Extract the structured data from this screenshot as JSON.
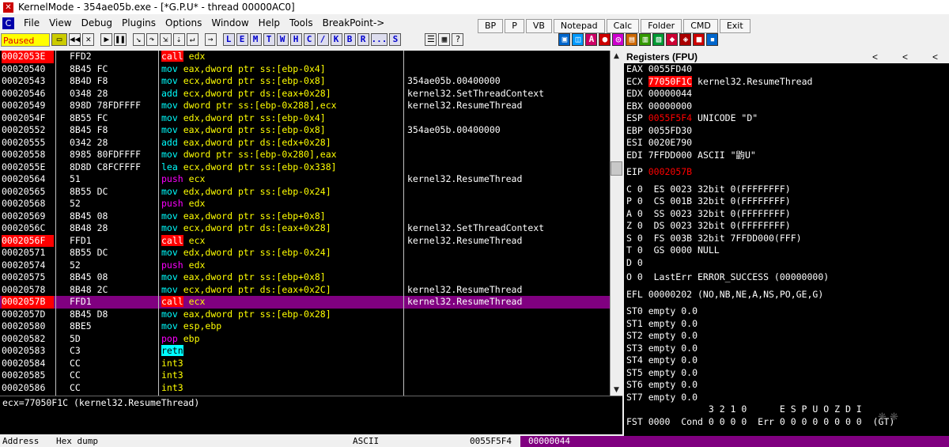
{
  "window": {
    "title": "KernelMode - 354ae05b.exe - [*G.P.U* - thread 00000AC0]"
  },
  "menu": [
    "File",
    "View",
    "Debug",
    "Plugins",
    "Options",
    "Window",
    "Help",
    "Tools",
    "BreakPoint->"
  ],
  "plugins": [
    "BP",
    "P",
    "VB",
    "Notepad",
    "Calc",
    "Folder",
    "CMD",
    "Exit"
  ],
  "status": "Paused",
  "toolbar_letters": [
    "L",
    "E",
    "M",
    "T",
    "W",
    "H",
    "C",
    "/",
    "K",
    "B",
    "R",
    "...",
    "S"
  ],
  "disasm": [
    {
      "addr": "0002053E",
      "hex": "FFD2",
      "op": "call",
      "args": "edx",
      "cmt": "",
      "addr_red": true,
      "sel": false
    },
    {
      "addr": "00020540",
      "hex": "8B45 FC",
      "op": "mov",
      "args": "eax,dword ptr ss:[ebp-0x4]",
      "cmt": ""
    },
    {
      "addr": "00020543",
      "hex": "8B4D F8",
      "op": "mov",
      "args": "ecx,dword ptr ss:[ebp-0x8]",
      "cmt": "354ae05b.00400000"
    },
    {
      "addr": "00020546",
      "hex": "0348 28",
      "op": "add",
      "args": "ecx,dword ptr ds:[eax+0x28]",
      "cmt": "kernel32.SetThreadContext"
    },
    {
      "addr": "00020549",
      "hex": "898D 78FDFFFF",
      "op": "mov",
      "args": "dword ptr ss:[ebp-0x288],ecx",
      "cmt": "kernel32.ResumeThread"
    },
    {
      "addr": "0002054F",
      "hex": "8B55 FC",
      "op": "mov",
      "args": "edx,dword ptr ss:[ebp-0x4]",
      "cmt": ""
    },
    {
      "addr": "00020552",
      "hex": "8B45 F8",
      "op": "mov",
      "args": "eax,dword ptr ss:[ebp-0x8]",
      "cmt": "354ae05b.00400000"
    },
    {
      "addr": "00020555",
      "hex": "0342 28",
      "op": "add",
      "args": "eax,dword ptr ds:[edx+0x28]",
      "cmt": ""
    },
    {
      "addr": "00020558",
      "hex": "8985 80FDFFFF",
      "op": "mov",
      "args": "dword ptr ss:[ebp-0x280],eax",
      "cmt": ""
    },
    {
      "addr": "0002055E",
      "hex": "8D8D C8FCFFFF",
      "op": "lea",
      "args": "ecx,dword ptr ss:[ebp-0x338]",
      "cmt": ""
    },
    {
      "addr": "00020564",
      "hex": "51",
      "op": "push",
      "args": "ecx",
      "cmt": "kernel32.ResumeThread"
    },
    {
      "addr": "00020565",
      "hex": "8B55 DC",
      "op": "mov",
      "args": "edx,dword ptr ss:[ebp-0x24]",
      "cmt": ""
    },
    {
      "addr": "00020568",
      "hex": "52",
      "op": "push",
      "args": "edx",
      "cmt": ""
    },
    {
      "addr": "00020569",
      "hex": "8B45 08",
      "op": "mov",
      "args": "eax,dword ptr ss:[ebp+0x8]",
      "cmt": ""
    },
    {
      "addr": "0002056C",
      "hex": "8B48 28",
      "op": "mov",
      "args": "ecx,dword ptr ds:[eax+0x28]",
      "cmt": "kernel32.SetThreadContext"
    },
    {
      "addr": "0002056F",
      "hex": "FFD1",
      "op": "call",
      "args": "ecx",
      "cmt": "kernel32.ResumeThread",
      "addr_red": true
    },
    {
      "addr": "00020571",
      "hex": "8B55 DC",
      "op": "mov",
      "args": "edx,dword ptr ss:[ebp-0x24]",
      "cmt": ""
    },
    {
      "addr": "00020574",
      "hex": "52",
      "op": "push",
      "args": "edx",
      "cmt": ""
    },
    {
      "addr": "00020575",
      "hex": "8B45 08",
      "op": "mov",
      "args": "eax,dword ptr ss:[ebp+0x8]",
      "cmt": ""
    },
    {
      "addr": "00020578",
      "hex": "8B48 2C",
      "op": "mov",
      "args": "ecx,dword ptr ds:[eax+0x2C]",
      "cmt": "kernel32.ResumeThread"
    },
    {
      "addr": "0002057B",
      "hex": "FFD1",
      "op": "call",
      "args": "ecx",
      "cmt": "kernel32.ResumeThread",
      "addr_red": true,
      "sel": true
    },
    {
      "addr": "0002057D",
      "hex": "8B45 D8",
      "op": "mov",
      "args": "eax,dword ptr ss:[ebp-0x28]",
      "cmt": ""
    },
    {
      "addr": "00020580",
      "hex": "8BE5",
      "op": "mov",
      "args": "esp,ebp",
      "cmt": ""
    },
    {
      "addr": "00020582",
      "hex": "5D",
      "op": "pop",
      "args": "ebp",
      "cmt": ""
    },
    {
      "addr": "00020583",
      "hex": "C3",
      "op": "retn",
      "args": "",
      "cmt": ""
    },
    {
      "addr": "00020584",
      "hex": "CC",
      "op": "int3",
      "args": "",
      "cmt": ""
    },
    {
      "addr": "00020585",
      "hex": "CC",
      "op": "int3",
      "args": "",
      "cmt": ""
    },
    {
      "addr": "00020586",
      "hex": "CC",
      "op": "int3",
      "args": "",
      "cmt": ""
    }
  ],
  "info_line": "ecx=77050F1C (kernel32.ResumeThread)",
  "registers": {
    "title": "Registers (FPU)",
    "gp": [
      {
        "name": "EAX",
        "value": "0055FD40",
        "note": "",
        "hl": false
      },
      {
        "name": "ECX",
        "value": "77050F1C",
        "note": "kernel32.ResumeThread",
        "hl": true
      },
      {
        "name": "EDX",
        "value": "00000044",
        "note": "",
        "hl": false
      },
      {
        "name": "EBX",
        "value": "00000000",
        "note": "",
        "hl": false
      },
      {
        "name": "ESP",
        "value": "0055F5F4",
        "note": "UNICODE \"D\"",
        "hl": "text"
      },
      {
        "name": "EBP",
        "value": "0055FD30",
        "note": "",
        "hl": false
      },
      {
        "name": "ESI",
        "value": "0020E790",
        "note": "",
        "hl": false
      },
      {
        "name": "EDI",
        "value": "7FFDD000",
        "note": "ASCII \"鼩U\"",
        "hl": false
      }
    ],
    "eip": {
      "name": "EIP",
      "value": "0002057B"
    },
    "flags": [
      "C 0  ES 0023 32bit 0(FFFFFFFF)",
      "P 0  CS 001B 32bit 0(FFFFFFFF)",
      "A 0  SS 0023 32bit 0(FFFFFFFF)",
      "Z 0  DS 0023 32bit 0(FFFFFFFF)",
      "S 0  FS 003B 32bit 7FFDD000(FFF)",
      "T 0  GS 0000 NULL",
      "D 0",
      "O 0  LastErr ERROR_SUCCESS (00000000)"
    ],
    "efl": "EFL 00000202 (NO,NB,NE,A,NS,PO,GE,G)",
    "st": [
      "ST0 empty 0.0",
      "ST1 empty 0.0",
      "ST2 empty 0.0",
      "ST3 empty 0.0",
      "ST4 empty 0.0",
      "ST5 empty 0.0",
      "ST6 empty 0.0",
      "ST7 empty 0.0"
    ],
    "fpu_header": "               3 2 1 0      E S P U O Z D I",
    "fst": "FST 0000  Cond 0 0 0 0  Err 0 0 0 0 0 0 0 0  (GT)"
  },
  "bottom": {
    "address": "Address",
    "hexdump": "Hex dump",
    "ascii": "ASCII",
    "stack_addr": "0055F5F4",
    "stack_val": "00000044"
  },
  "colors": {
    "red": "#ff0000",
    "purple": "#800080",
    "cyan": "#00ffff",
    "yellow": "#ffff00",
    "magenta": "#ff00ff"
  }
}
